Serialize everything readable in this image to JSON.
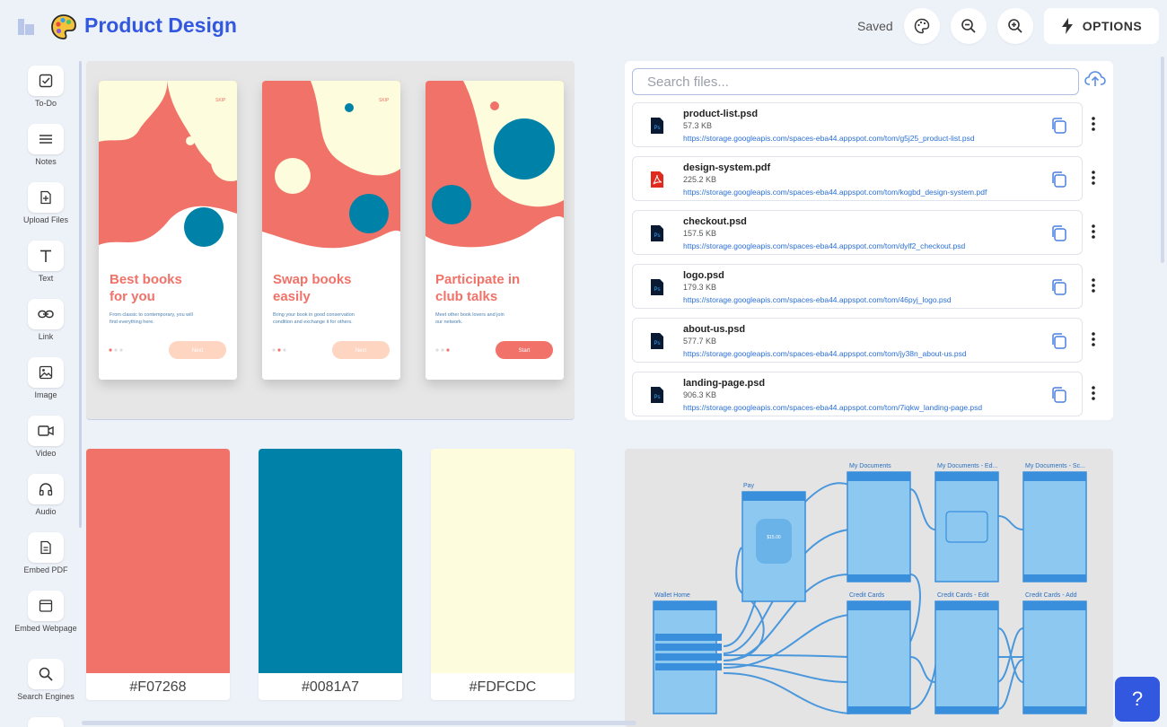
{
  "header": {
    "title": "Product Design",
    "saved_status": "Saved",
    "options_label": "OPTIONS"
  },
  "sidebar": {
    "tools": [
      {
        "label": "To-Do",
        "icon": "checkbox-icon"
      },
      {
        "label": "Notes",
        "icon": "lines-icon"
      },
      {
        "label": "Upload Files",
        "icon": "file-upload-icon"
      },
      {
        "label": "Text",
        "icon": "text-icon"
      },
      {
        "label": "Link",
        "icon": "link-icon"
      },
      {
        "label": "Image",
        "icon": "image-icon"
      },
      {
        "label": "Video",
        "icon": "video-icon"
      },
      {
        "label": "Audio",
        "icon": "headphones-icon"
      },
      {
        "label": "Embed PDF",
        "icon": "pdf-icon"
      },
      {
        "label": "Embed Webpage",
        "icon": "webpage-icon"
      },
      {
        "label": "Search Engines",
        "icon": "search-icon"
      }
    ]
  },
  "mockups": [
    {
      "heading": "Best books for you",
      "body": "From classic to contemporary, you will find everything here.",
      "button": "Next",
      "skip": "SKIP"
    },
    {
      "heading": "Swap books easily",
      "body": "Bring your book in good conservation condition and exchange it for others.",
      "button": "Next",
      "skip": "SKIP"
    },
    {
      "heading": "Participate in club talks",
      "body": "Meet other book lovers and join our network.",
      "button": "Start",
      "skip": ""
    }
  ],
  "files": {
    "search_placeholder": "Search files...",
    "items": [
      {
        "name": "product-list.psd",
        "size": "57.3 KB",
        "url": "https://storage.googleapis.com/spaces-eba44.appspot.com/tom/g5j25_product-list.psd",
        "type": "psd"
      },
      {
        "name": "design-system.pdf",
        "size": "225.2 KB",
        "url": "https://storage.googleapis.com/spaces-eba44.appspot.com/tom/kogbd_design-system.pdf",
        "type": "pdf"
      },
      {
        "name": "checkout.psd",
        "size": "157.5 KB",
        "url": "https://storage.googleapis.com/spaces-eba44.appspot.com/tom/dylf2_checkout.psd",
        "type": "psd"
      },
      {
        "name": "logo.psd",
        "size": "179.3 KB",
        "url": "https://storage.googleapis.com/spaces-eba44.appspot.com/tom/46pyj_logo.psd",
        "type": "psd"
      },
      {
        "name": "about-us.psd",
        "size": "577.7 KB",
        "url": "https://storage.googleapis.com/spaces-eba44.appspot.com/tom/jy38n_about-us.psd",
        "type": "psd"
      },
      {
        "name": "landing-page.psd",
        "size": "906.3 KB",
        "url": "https://storage.googleapis.com/spaces-eba44.appspot.com/tom/7iqkw_landing-page.psd",
        "type": "psd"
      }
    ]
  },
  "swatches": [
    {
      "label": "#F07268",
      "color": "#F07268"
    },
    {
      "label": "#0081A7",
      "color": "#0081A7"
    },
    {
      "label": "#FDFCDC",
      "color": "#FDFCDC"
    }
  ],
  "flow": {
    "screens": [
      "Pay",
      "Wallet Home",
      "My Documents",
      "My Documents - Ed...",
      "My Documents - Sc...",
      "Credit Cards",
      "Credit Cards - Edit",
      "Credit Cards - Add"
    ],
    "amount": "$15.00"
  },
  "help_label": "?",
  "colors": {
    "accent": "#3358E0",
    "coral": "#F07268",
    "teal": "#0081A7",
    "cream": "#FDFCDC",
    "flow_blue": "#8CC8F0"
  }
}
